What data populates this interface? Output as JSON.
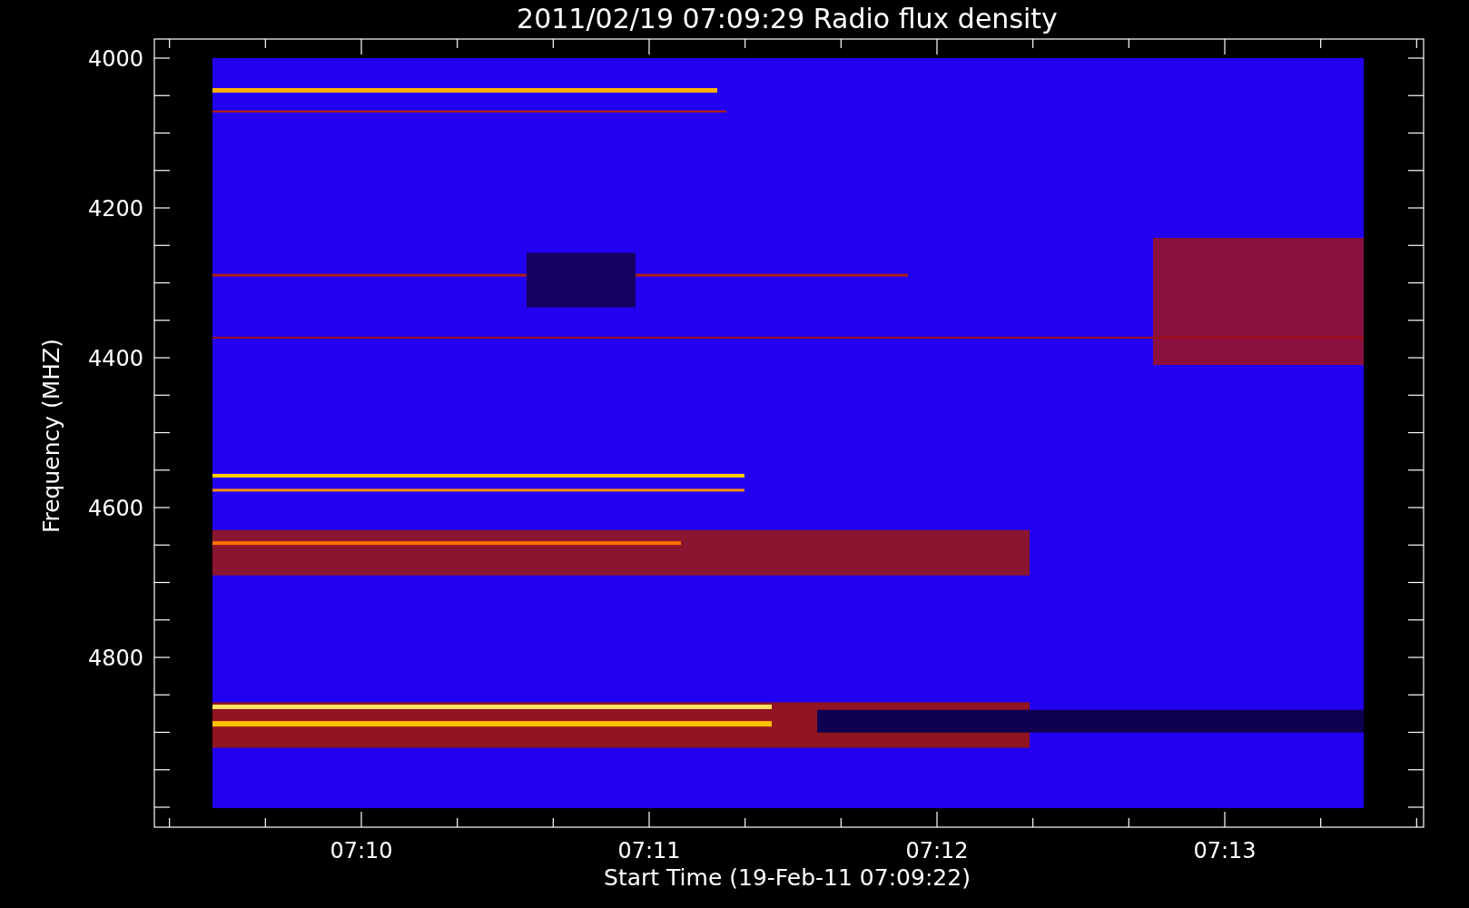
{
  "plot": {
    "title": "2011/02/19 07:09:29 Radio flux density",
    "y_axis_label": "Frequency (MHZ)",
    "y_tick_labels": [
      "4000",
      "4200",
      "4400",
      "4600",
      "4800"
    ],
    "x_axis_label": "Start Time (19-Feb-11 07:09:22)",
    "x_tick_labels": [
      "07:10",
      "07:11",
      "07:12",
      "07:13"
    ]
  }
}
